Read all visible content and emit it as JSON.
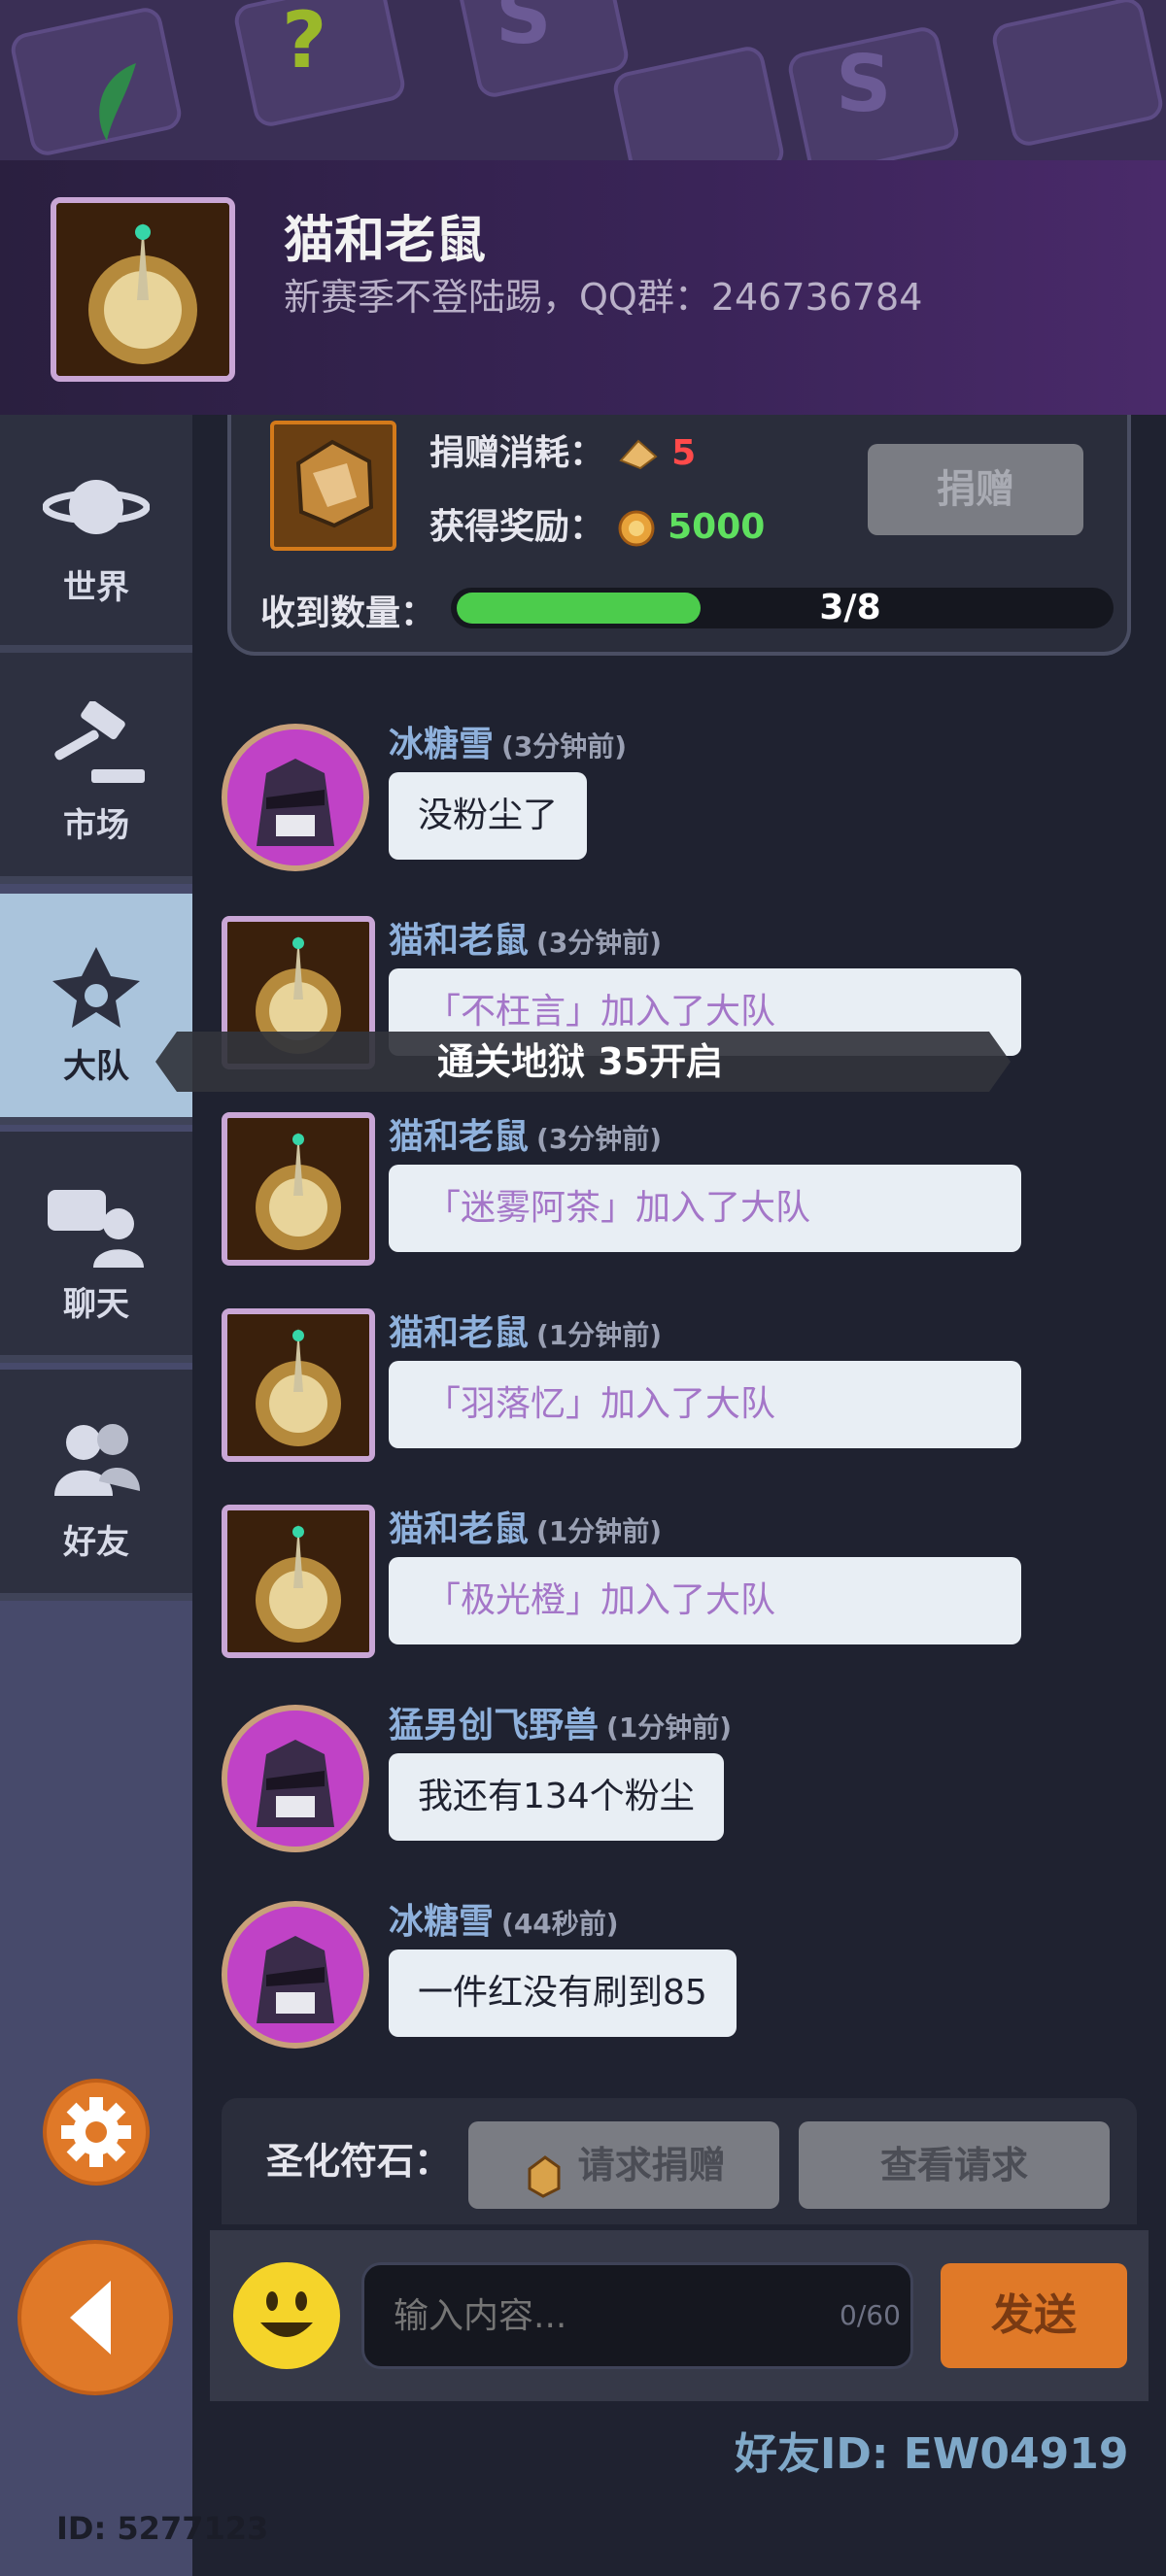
{
  "header": {
    "title": "猫和老鼠",
    "subtitle": "新赛季不登陆踢，QQ群：246736784"
  },
  "sidebar": {
    "items": [
      {
        "label": "世界",
        "icon": "planet-icon",
        "active": false
      },
      {
        "label": "市场",
        "icon": "gavel-icon",
        "active": false
      },
      {
        "label": "大队",
        "icon": "guild-emblem-icon",
        "active": true
      },
      {
        "label": "聊天",
        "icon": "chat-icon",
        "active": false
      },
      {
        "label": "好友",
        "icon": "friends-icon",
        "active": false
      }
    ]
  },
  "donate_card": {
    "cost_label": "捐赠消耗：",
    "cost_value": "5",
    "reward_label": "获得奖励：",
    "reward_value": "5000",
    "donate_button": "捐赠",
    "received_label": "收到数量：",
    "progress_text": "3/8",
    "progress_fraction": 0.375
  },
  "tooltip": "通关地狱 35开启",
  "messages": [
    {
      "name": "冰糖雪",
      "time": "(3分钟前)",
      "text": "没粉尘了",
      "system": false,
      "avatar": "hooded-avatar"
    },
    {
      "name": "猫和老鼠",
      "time": "(3分钟前)",
      "text": "「不枉言」加入了大队",
      "system": true,
      "avatar": "guild-avatar"
    },
    {
      "name": "猫和老鼠",
      "time": "(3分钟前)",
      "text": "「迷雾阿茶」加入了大队",
      "system": true,
      "avatar": "guild-avatar"
    },
    {
      "name": "猫和老鼠",
      "time": "(1分钟前)",
      "text": "「羽落忆」加入了大队",
      "system": true,
      "avatar": "guild-avatar"
    },
    {
      "name": "猫和老鼠",
      "time": "(1分钟前)",
      "text": "「极光橙」加入了大队",
      "system": true,
      "avatar": "guild-avatar"
    },
    {
      "name": "猛男创飞野兽",
      "time": "(1分钟前)",
      "text": "我还有134个粉尘",
      "system": false,
      "avatar": "hooded-avatar"
    },
    {
      "name": "冰糖雪",
      "time": "(44秒前)",
      "text": "一件红没有刷到85",
      "system": false,
      "avatar": "hooded-avatar"
    }
  ],
  "request_bar": {
    "label": "圣化符石：",
    "request_button": "请求捐赠",
    "view_button": "查看请求"
  },
  "input_bar": {
    "placeholder": "输入内容...",
    "counter": "0/60",
    "send_button": "发送"
  },
  "friend_id": "好友ID: EW04919",
  "user_id": "ID: 5277123",
  "colors": {
    "accent_orange": "#e07928",
    "progress_green": "#4ccc4c",
    "name_blue": "#8fb1dc",
    "system_purple": "#a476c8"
  }
}
